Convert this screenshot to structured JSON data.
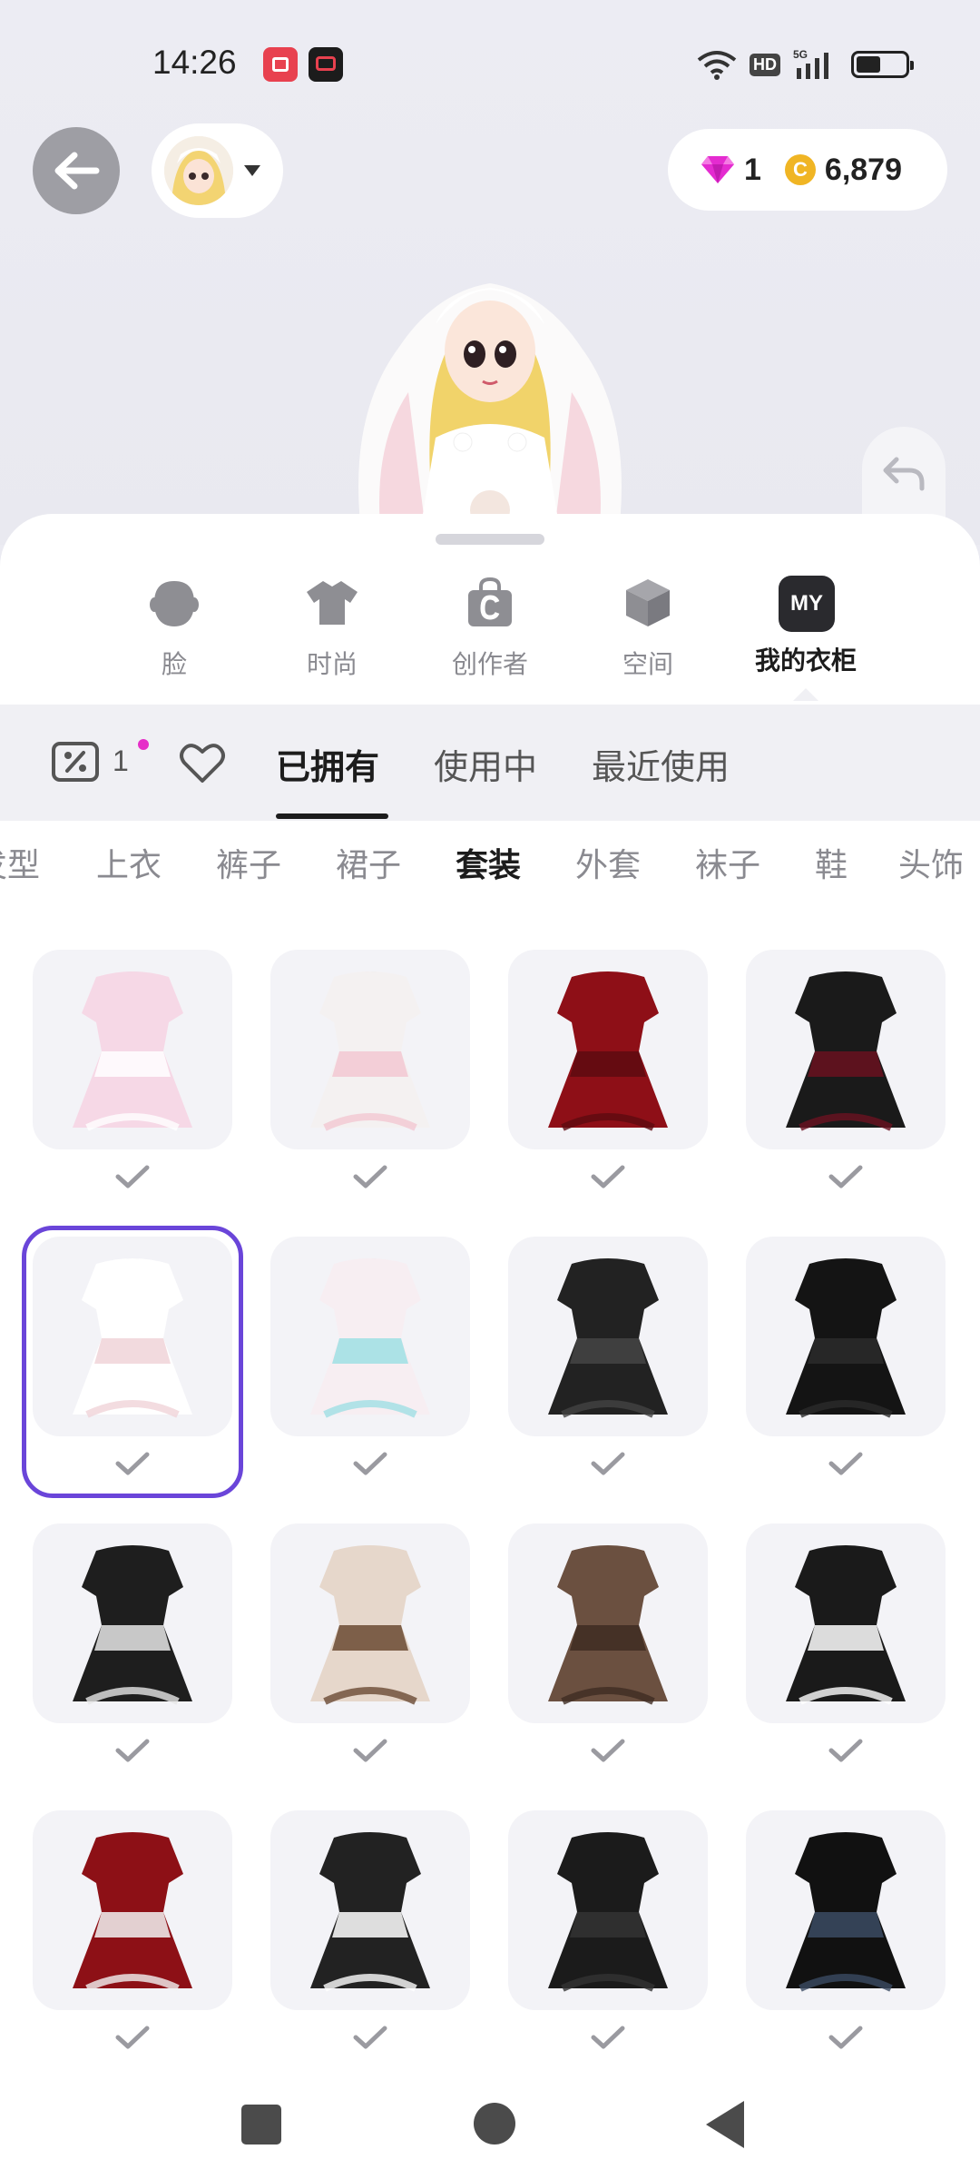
{
  "status_bar": {
    "time": "14:26",
    "network": "5G",
    "hd_label": "HD"
  },
  "header": {
    "gems": "1",
    "coins": "6,879"
  },
  "category_tabs": [
    {
      "label": "脸",
      "icon": "face-icon",
      "active": false
    },
    {
      "label": "时尚",
      "icon": "tshirt-icon",
      "active": false
    },
    {
      "label": "创作者",
      "icon": "creator-bag-icon",
      "active": false
    },
    {
      "label": "空间",
      "icon": "cube-icon",
      "active": false
    },
    {
      "label": "我的衣柜",
      "icon": "my-wardrobe-icon",
      "badge": "MY",
      "active": true
    }
  ],
  "subtabs": {
    "coupon_count": "1",
    "items": [
      {
        "label": "已拥有",
        "active": true
      },
      {
        "label": "使用中",
        "active": false
      },
      {
        "label": "最近使用",
        "active": false
      }
    ]
  },
  "filters": [
    {
      "label": "发型",
      "active": false
    },
    {
      "label": "上衣",
      "active": false
    },
    {
      "label": "裤子",
      "active": false
    },
    {
      "label": "裙子",
      "active": false
    },
    {
      "label": "套装",
      "active": true
    },
    {
      "label": "外套",
      "active": false
    },
    {
      "label": "袜子",
      "active": false
    },
    {
      "label": "鞋",
      "active": false
    },
    {
      "label": "头饰",
      "active": false
    }
  ],
  "outfits": [
    {
      "name": "pink-maid-dress",
      "owned": true,
      "selected": false,
      "colors": [
        "#f6d8e6",
        "#ffffff"
      ]
    },
    {
      "name": "white-pink-bunny-outfit",
      "owned": true,
      "selected": false,
      "colors": [
        "#f4f1f1",
        "#f2c8d2"
      ]
    },
    {
      "name": "red-corset-dress",
      "owned": true,
      "selected": false,
      "colors": [
        "#8e0f17",
        "#5e0a10"
      ]
    },
    {
      "name": "gothic-lace-set",
      "owned": true,
      "selected": false,
      "colors": [
        "#1a1a1a",
        "#6a1220"
      ]
    },
    {
      "name": "white-bunny-hoodie",
      "owned": true,
      "selected": true,
      "colors": [
        "#ffffff",
        "#f0d3d8"
      ]
    },
    {
      "name": "pastel-lolita-dress",
      "owned": true,
      "selected": false,
      "colors": [
        "#f7eef2",
        "#9fdfe4"
      ]
    },
    {
      "name": "black-fur-crop-set",
      "owned": true,
      "selected": false,
      "colors": [
        "#222222",
        "#444444"
      ]
    },
    {
      "name": "black-victorian-gown",
      "owned": true,
      "selected": false,
      "colors": [
        "#141414",
        "#2a2a2a"
      ]
    },
    {
      "name": "black-tweed-pearl-set",
      "owned": true,
      "selected": false,
      "colors": [
        "#1e1e1e",
        "#e6e6e6"
      ]
    },
    {
      "name": "fur-coat-brown-skirt",
      "owned": true,
      "selected": false,
      "colors": [
        "#e6d7cb",
        "#6a4a33"
      ]
    },
    {
      "name": "brown-offshoulder-top",
      "owned": true,
      "selected": false,
      "colors": [
        "#6b5040",
        "#3e2c22"
      ]
    },
    {
      "name": "polka-dot-scarf-dress",
      "owned": true,
      "selected": false,
      "colors": [
        "#1a1a1a",
        "#ffffff"
      ]
    },
    {
      "name": "red-skeleton-dress",
      "owned": true,
      "selected": false,
      "colors": [
        "#8d1016",
        "#f2f2f2"
      ]
    },
    {
      "name": "black-ruffle-gown",
      "owned": true,
      "selected": false,
      "colors": [
        "#222222",
        "#ffffff"
      ]
    },
    {
      "name": "black-leather-coat",
      "owned": true,
      "selected": false,
      "colors": [
        "#1b1b1b",
        "#333333"
      ]
    },
    {
      "name": "black-feather-gown",
      "owned": true,
      "selected": false,
      "colors": [
        "#111111",
        "#3b4b63"
      ]
    }
  ],
  "colors": {
    "accent_selected": "#6a45d9",
    "notification_dot": "#e62ec8",
    "coin": "#f0b524",
    "gem": "#e42bd0"
  }
}
